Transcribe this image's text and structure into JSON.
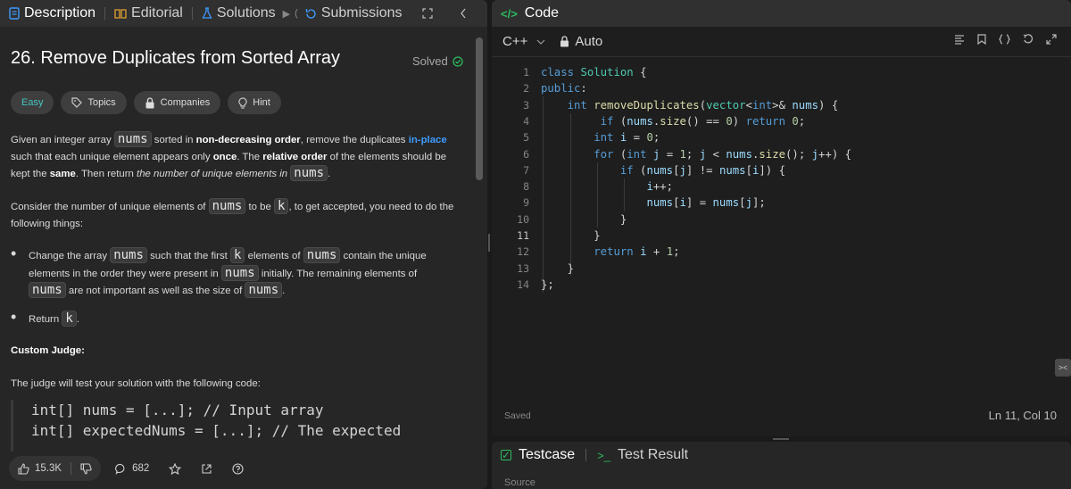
{
  "left_tabs": {
    "description": "Description",
    "editorial": "Editorial",
    "solutions": "Solutions",
    "history_fragment": "(",
    "submissions": "Submissions"
  },
  "problem": {
    "title": "26. Remove Duplicates from Sorted Array",
    "status": "Solved",
    "tags": {
      "difficulty": "Easy",
      "topics": "Topics",
      "companies": "Companies",
      "hint": "Hint"
    }
  },
  "description": {
    "p1_a": "Given an integer array",
    "p1_code1": "nums",
    "p1_b": "sorted in",
    "p1_bold1": "non-decreasing order",
    "p1_c": ", remove the duplicates",
    "p1_link": "in-place",
    "p1_d": "such that each unique element appears only",
    "p1_bold2": "once",
    "p1_e": ". The",
    "p1_bold3": "relative order",
    "p1_f": "of the elements should be kept the",
    "p1_bold4": "same",
    "p1_g": ". Then return",
    "p1_italic": "the number of unique elements in",
    "p1_code2": "nums",
    "p1_h": ".",
    "p2_a": "Consider the number of unique elements of",
    "p2_code1": "nums",
    "p2_b": "to be",
    "p2_code2": "k",
    "p2_c": ", to get accepted, you need to do the following things:",
    "b1_a": "Change the array",
    "b1_code1": "nums",
    "b1_b": "such that the first",
    "b1_code2": "k",
    "b1_c": "elements of",
    "b1_code3": "nums",
    "b1_d": "contain the unique elements in the order they were present in",
    "b1_code4": "nums",
    "b1_e": "initially. The remaining elements of",
    "b1_code5": "nums",
    "b1_f": "are not important as well as the size of",
    "b1_code6": "nums",
    "b1_g": ".",
    "b2_a": "Return",
    "b2_code": "k",
    "b2_b": ".",
    "custom_judge": "Custom Judge:",
    "judge_text": "The judge will test your solution with the following code:",
    "judge_code_1": "int[] nums = [...]; // Input array",
    "judge_code_2": "int[] expectedNums = [...]; // The expected"
  },
  "footer": {
    "likes": "15.3K",
    "comments": "682"
  },
  "right_tabs": {
    "code": "Code"
  },
  "editor": {
    "language": "C++",
    "mode": "Auto",
    "lines": [
      {
        "n": "1"
      },
      {
        "n": "2"
      },
      {
        "n": "3"
      },
      {
        "n": "4"
      },
      {
        "n": "5"
      },
      {
        "n": "6"
      },
      {
        "n": "7"
      },
      {
        "n": "8"
      },
      {
        "n": "9"
      },
      {
        "n": "10"
      },
      {
        "n": "11"
      },
      {
        "n": "12"
      },
      {
        "n": "13"
      },
      {
        "n": "14"
      }
    ],
    "saved": "Saved",
    "cursor": "Ln 11, Col 10"
  },
  "bottom_tabs": {
    "testcase": "Testcase",
    "test_result": "Test Result",
    "sub": "Source"
  },
  "colors": {
    "accent_green": "#2cbb5d",
    "easy": "#46c6c2",
    "link": "#3e9bff"
  },
  "icons": [
    "description-icon",
    "editorial-icon",
    "solutions-icon",
    "submissions-icon",
    "expand-icon",
    "chevron-left-icon",
    "check-circle-icon",
    "tag-icon",
    "lock-icon",
    "bulb-icon",
    "thumbs-up-icon",
    "thumbs-down-icon",
    "comment-icon",
    "star-icon",
    "share-icon",
    "help-icon",
    "code-icon",
    "chevron-down-icon",
    "format-icon",
    "bookmark-icon",
    "braces-icon",
    "reset-icon",
    "fullscreen-icon",
    "checkbox-icon",
    "terminal-icon"
  ]
}
